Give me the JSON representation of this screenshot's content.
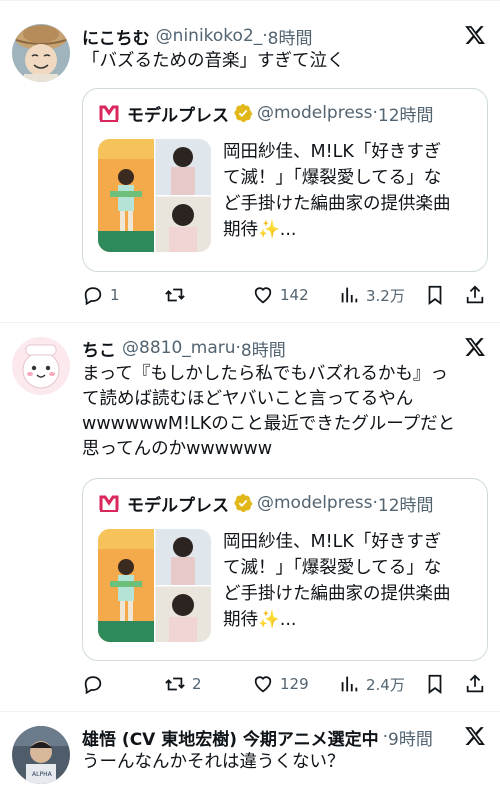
{
  "posts": [
    {
      "name": "にこちむ",
      "handle": "@ninikoko2_",
      "separator": "·",
      "time": "8時間",
      "text_lines": [
        "「バズるための音楽」すぎて泣く"
      ],
      "quote": {
        "name": "モデルプレス",
        "handle": "@modelpress",
        "separator": "·",
        "time": "12時間",
        "text_lines": [
          "岡田紗佳、M!LK「好きすぎ",
          "て滅！」「爆裂愛してる」な",
          "ど手掛けた編曲家の提供楽曲",
          "期待✨..."
        ]
      },
      "actions": {
        "reply": "1",
        "retweet": "",
        "like": "142",
        "views": "3.2万"
      }
    },
    {
      "name": "ちこ",
      "handle": "@8810_maru",
      "separator": "·",
      "time": "8時間",
      "text_lines": [
        "まって『もしかしたら私でもバズれるかも』っ",
        "て読めば読むほどヤバいこと言ってるやん",
        "wwwwwwM!LKのこと最近できたグループだと",
        "思ってんのかwwwwww"
      ],
      "quote": {
        "name": "モデルプレス",
        "handle": "@modelpress",
        "separator": "·",
        "time": "12時間",
        "text_lines": [
          "岡田紗佳、M!LK「好きすぎ",
          "て滅！」「爆裂愛してる」な",
          "ど手掛けた編曲家の提供楽曲",
          "期待✨..."
        ]
      },
      "actions": {
        "reply": "",
        "retweet": "2",
        "like": "129",
        "views": "2.4万"
      }
    },
    {
      "name": "雄悟 (CV 東地宏樹) 今期アニメ選定中",
      "separator": "·",
      "time": "9時間",
      "text_lines": [
        "うーんなんかそれは違うくない？"
      ]
    }
  ],
  "colors": {
    "text": "#0f1419",
    "muted": "#536471",
    "border": "#cfd9de",
    "divider": "#eff3f4",
    "verified": "#e2b719",
    "modelpress_logo": "#d9275b"
  },
  "icons": [
    "x-logo-icon",
    "verified-icon",
    "reply-icon",
    "retweet-icon",
    "like-icon",
    "views-icon",
    "bookmark-icon",
    "share-icon"
  ]
}
